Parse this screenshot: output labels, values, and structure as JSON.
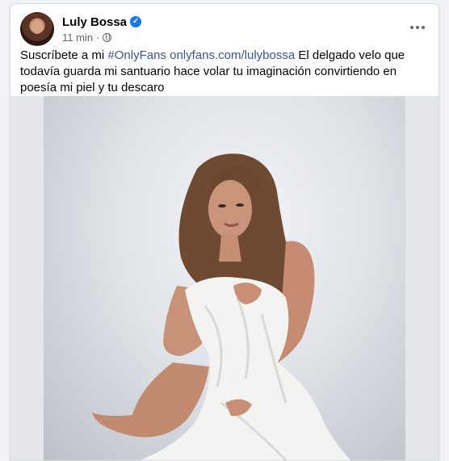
{
  "post": {
    "author": "Luly Bossa",
    "time": "11 min",
    "dot": "·",
    "text_prefix": "Suscríbete a mi ",
    "hashtag": "#OnlyFans",
    "link": "onlyfans.com/lulybossa",
    "text_body": " El delgado velo que todavía guarda mi santuario hace volar tu imaginación convirtiendo en poesía mi piel y tu descaro",
    "space": " "
  },
  "icons": {
    "verified": "verified-badge-icon",
    "audience": "globe-icon",
    "more": "more-options-icon"
  },
  "colors": {
    "link": "#385898",
    "verified": "#1877f2"
  }
}
